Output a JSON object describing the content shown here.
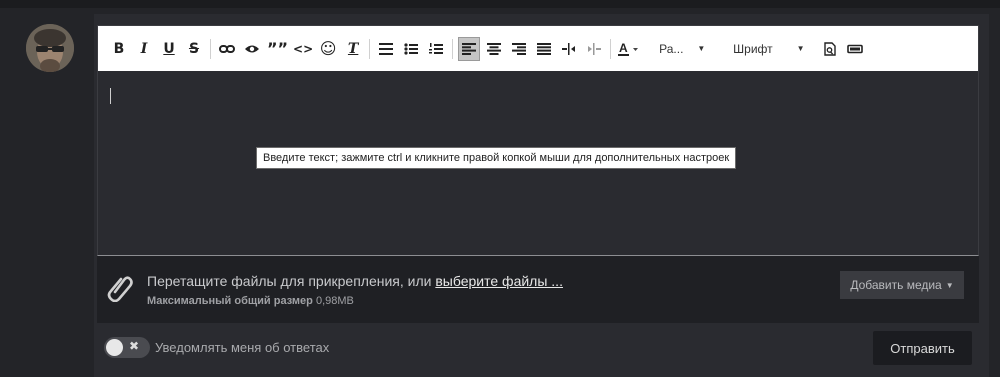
{
  "toolbar": {
    "bold": "B",
    "italic": "I",
    "underline": "U",
    "strike": "S",
    "quote": "””",
    "code": "<>",
    "smile": "☺",
    "clear_format": "T",
    "paragraph_label": "Ра...",
    "font_label": "Шрифт"
  },
  "editor": {
    "tooltip": "Введите текст; зажмите ctrl и кликните правой копкой мыши для дополнительных настроек"
  },
  "attachments": {
    "prompt": "Перетащите файлы для прикрепления, или ",
    "choose_link": "выберите файлы ...",
    "max_label": "Максимальный общий размер",
    "max_value": "0,98MB",
    "add_media": "Добавить медиа"
  },
  "footer": {
    "toggle_symbol": "✖",
    "notify_label": "Уведомлять меня об ответах",
    "submit": "Отправить"
  }
}
